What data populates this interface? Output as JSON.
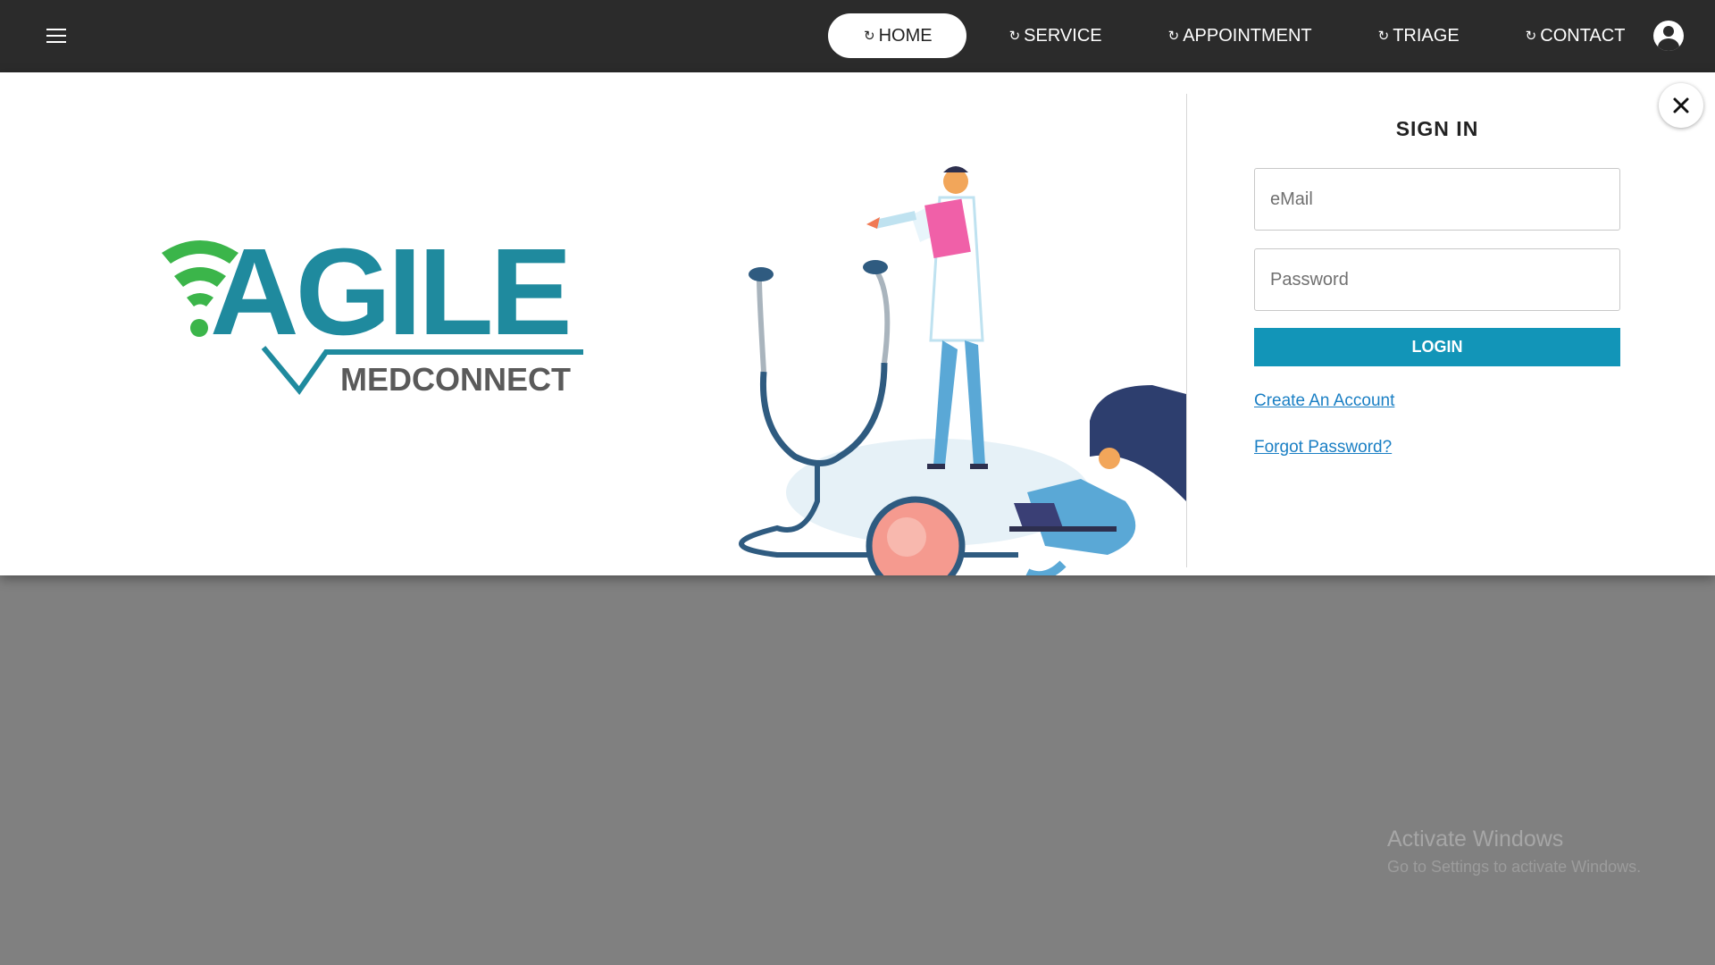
{
  "nav": {
    "items": [
      {
        "label": "HOME",
        "icon": "refresh-icon",
        "active": true
      },
      {
        "label": "SERVICE",
        "icon": "refresh-icon",
        "active": false
      },
      {
        "label": "APPOINTMENT",
        "icon": "refresh-icon",
        "active": false
      },
      {
        "label": "TRIAGE",
        "icon": "refresh-icon",
        "active": false
      },
      {
        "label": "CONTACT",
        "icon": "refresh-icon",
        "active": false
      }
    ],
    "menu_icon": "hamburger-icon",
    "account_icon": "user-circle-icon"
  },
  "modal": {
    "close_icon": "close-icon",
    "logo": {
      "brand": "AGILE",
      "sub": "MEDCONNECT"
    },
    "signin": {
      "title": "SIGN IN",
      "email_placeholder": "eMail",
      "password_placeholder": "Password",
      "login_label": "LOGIN",
      "create_account": "Create An Account",
      "forgot_password": "Forgot Password?"
    }
  },
  "watermark": {
    "line1": "Activate Windows",
    "line2": "Go to Settings to activate Windows."
  },
  "colors": {
    "nav_bg": "#2b2b2b",
    "accent": "#1295b8",
    "link": "#1a7fc4",
    "logo_teal": "#1f8a9e",
    "logo_green": "#3bb54a",
    "overlay": "#808080"
  }
}
